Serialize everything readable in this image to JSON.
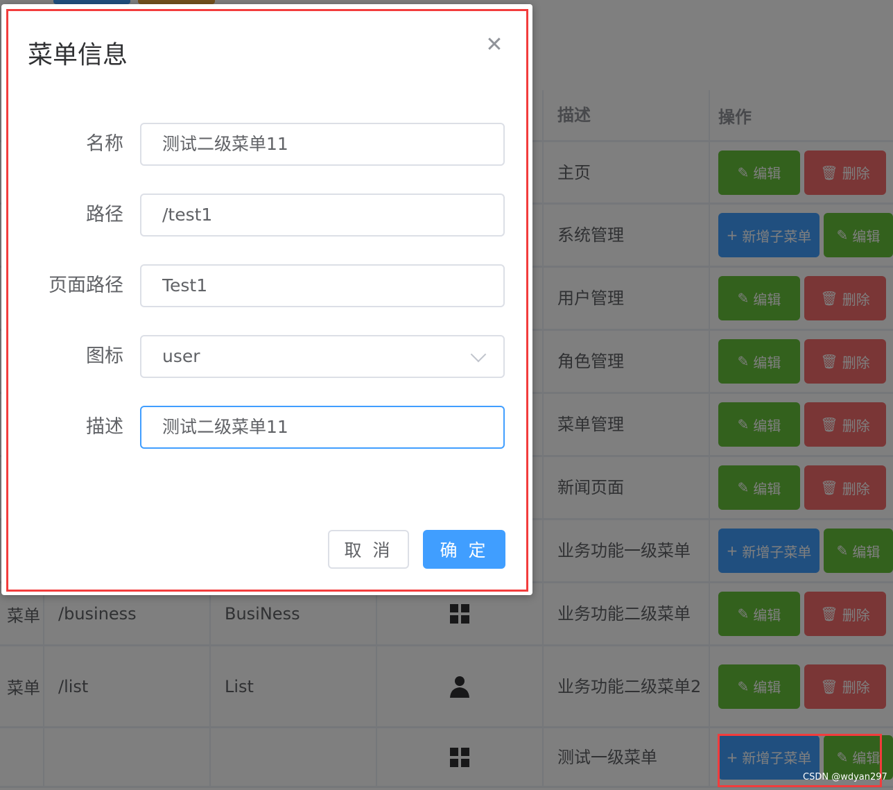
{
  "table": {
    "headers": [
      "",
      "",
      "",
      "",
      "描述",
      "操作"
    ],
    "rows": [
      {
        "name": "",
        "path": "",
        "component": "",
        "icon": "",
        "desc": "主页",
        "actions": [
          "edit",
          "delete"
        ]
      },
      {
        "name": "",
        "path": "",
        "component": "",
        "icon": "",
        "desc": "系统管理",
        "actions": [
          "add",
          "edit"
        ]
      },
      {
        "name": "",
        "path": "",
        "component": "",
        "icon": "",
        "desc": "用户管理",
        "actions": [
          "edit",
          "delete"
        ]
      },
      {
        "name": "",
        "path": "",
        "component": "",
        "icon": "",
        "desc": "角色管理",
        "actions": [
          "edit",
          "delete"
        ]
      },
      {
        "name": "",
        "path": "",
        "component": "",
        "icon": "",
        "desc": "菜单管理",
        "actions": [
          "edit",
          "delete"
        ]
      },
      {
        "name": "",
        "path": "",
        "component": "",
        "icon": "",
        "desc": "新闻页面",
        "actions": [
          "edit",
          "delete"
        ]
      },
      {
        "name": "",
        "path": "",
        "component": "",
        "icon": "",
        "desc": "业务功能一级菜单",
        "actions": [
          "add",
          "edit"
        ]
      },
      {
        "name": "菜单",
        "path": "/business",
        "component": "BusiNess",
        "icon": "grid",
        "desc": "业务功能二级菜单",
        "actions": [
          "edit",
          "delete"
        ]
      },
      {
        "name": "菜单",
        "path": "/list",
        "component": "List",
        "icon": "user",
        "desc": "业务功能二级菜单2",
        "actions": [
          "edit",
          "delete"
        ]
      },
      {
        "name": "",
        "path": "",
        "component": "",
        "icon": "grid",
        "desc": "测试一级菜单",
        "actions": [
          "add",
          "edit"
        ]
      }
    ],
    "edit_label": "编辑",
    "delete_label": "删除",
    "add_label": "新增子菜单"
  },
  "dialog": {
    "title": "菜单信息",
    "fields": [
      {
        "label": "名称",
        "value": "测试二级菜单11"
      },
      {
        "label": "路径",
        "value": "/test1"
      },
      {
        "label": "页面路径",
        "value": "Test1"
      },
      {
        "label": "图标",
        "value": "user"
      },
      {
        "label": "描述",
        "value": "测试二级菜单11"
      }
    ],
    "cancel": "取 消",
    "confirm": "确 定"
  },
  "watermark": "CSDN @wdyan297",
  "colors": {
    "primary": "#409eff",
    "success": "#67c23a",
    "danger": "#f56c6c",
    "warning": "#e6a23c",
    "highlight": "#f23c3c"
  }
}
